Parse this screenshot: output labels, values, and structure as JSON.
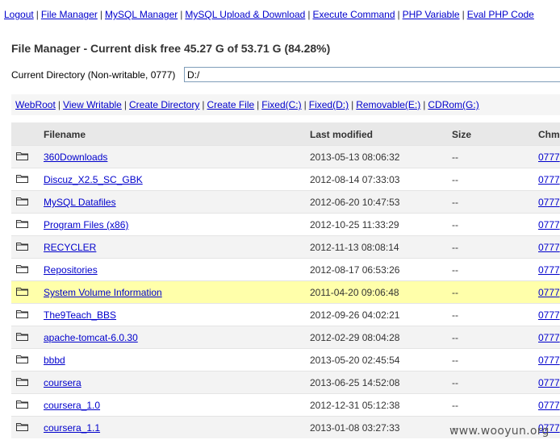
{
  "topnav": [
    {
      "label": "Logout"
    },
    {
      "label": "File Manager"
    },
    {
      "label": "MySQL Manager"
    },
    {
      "label": "MySQL Upload & Download"
    },
    {
      "label": "Execute Command"
    },
    {
      "label": "PHP Variable"
    },
    {
      "label": "Eval PHP Code"
    }
  ],
  "separator": "|",
  "heading": "File Manager - Current disk free 45.27 G of 53.71 G (84.28%)",
  "current_dir": {
    "label": "Current Directory (Non-writable, 0777)",
    "value": "D:/"
  },
  "subnav": [
    {
      "label": "WebRoot"
    },
    {
      "label": "View Writable"
    },
    {
      "label": "Create Directory"
    },
    {
      "label": "Create File"
    },
    {
      "label": "Fixed(C:)"
    },
    {
      "label": "Fixed(D:)"
    },
    {
      "label": "Removable(E:)"
    },
    {
      "label": "CDRom(G:)"
    }
  ],
  "table": {
    "headers": {
      "filename": "Filename",
      "modified": "Last modified",
      "size": "Size",
      "chmod": "Chmo"
    },
    "rows": [
      {
        "name": "360Downloads",
        "modified": "2013-05-13 08:06:32",
        "size": "--",
        "chmod": "0777"
      },
      {
        "name": "Discuz_X2.5_SC_GBK",
        "modified": "2012-08-14 07:33:03",
        "size": "--",
        "chmod": "0777"
      },
      {
        "name": "MySQL Datafiles",
        "modified": "2012-06-20 10:47:53",
        "size": "--",
        "chmod": "0777"
      },
      {
        "name": "Program Files (x86)",
        "modified": "2012-10-25 11:33:29",
        "size": "--",
        "chmod": "0777"
      },
      {
        "name": "RECYCLER",
        "modified": "2012-11-13 08:08:14",
        "size": "--",
        "chmod": "0777"
      },
      {
        "name": "Repositories",
        "modified": "2012-08-17 06:53:26",
        "size": "--",
        "chmod": "0777"
      },
      {
        "name": "System Volume Information",
        "modified": "2011-04-20 09:06:48",
        "size": "--",
        "chmod": "0777"
      },
      {
        "name": "The9Teach_BBS",
        "modified": "2012-09-26 04:02:21",
        "size": "--",
        "chmod": "0777"
      },
      {
        "name": "apache-tomcat-6.0.30",
        "modified": "2012-02-29 08:04:28",
        "size": "--",
        "chmod": "0777"
      },
      {
        "name": "bbbd",
        "modified": "2013-05-20 02:45:54",
        "size": "--",
        "chmod": "0777"
      },
      {
        "name": "coursera",
        "modified": "2013-06-25 14:52:08",
        "size": "--",
        "chmod": "0777"
      },
      {
        "name": "coursera_1.0",
        "modified": "2012-12-31 05:12:38",
        "size": "--",
        "chmod": "0777"
      },
      {
        "name": "coursera_1.1",
        "modified": "2013-01-08 03:27:33",
        "size": "--",
        "chmod": "0777"
      }
    ],
    "highlighted_row": 6
  },
  "row_icon": "folder-icon",
  "watermark": "www.wooyun.org",
  "colors": {
    "link": "#0000cc",
    "highlight": "#ffffaa",
    "header_bg": "#e8e8e8",
    "alt_row": "#f3f3f3"
  }
}
